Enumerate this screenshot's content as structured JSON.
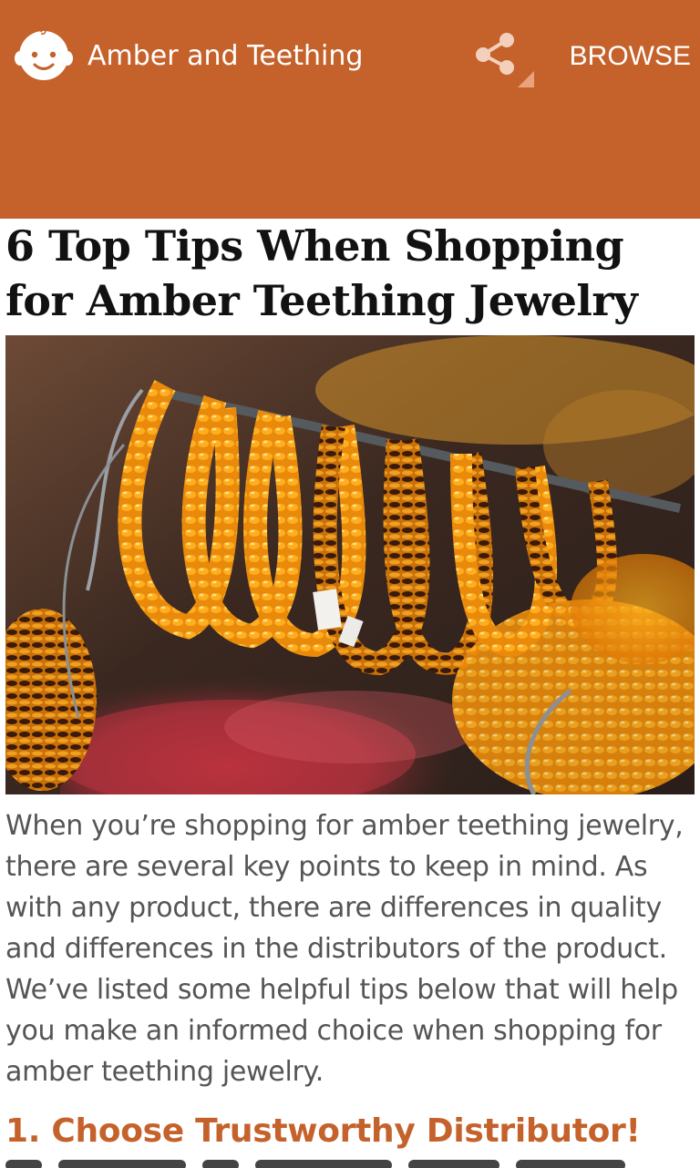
{
  "app_bar": {
    "title": "Amber and Teething",
    "browse_label": "BROWSE",
    "logo_icon": "baby-face-icon",
    "share_icon": "share-icon",
    "background": "#c5622b"
  },
  "article": {
    "title": "6 Top Tips When Shopping for Amber Teething Jewelry",
    "hero_image": "amber-necklaces-photo",
    "intro": "When you’re shopping for amber teething jewelry, there are several key points to keep in mind. As with any product, there are differences in quality and differences in the distributors of the product. We’ve listed some helpful tips below that will help you make an informed choice when shopping for amber teething jewelry.",
    "section_heading": "1. Choose Trustworthy Distributor!",
    "heading_color": "#c5622b",
    "text_color": "#555555"
  }
}
